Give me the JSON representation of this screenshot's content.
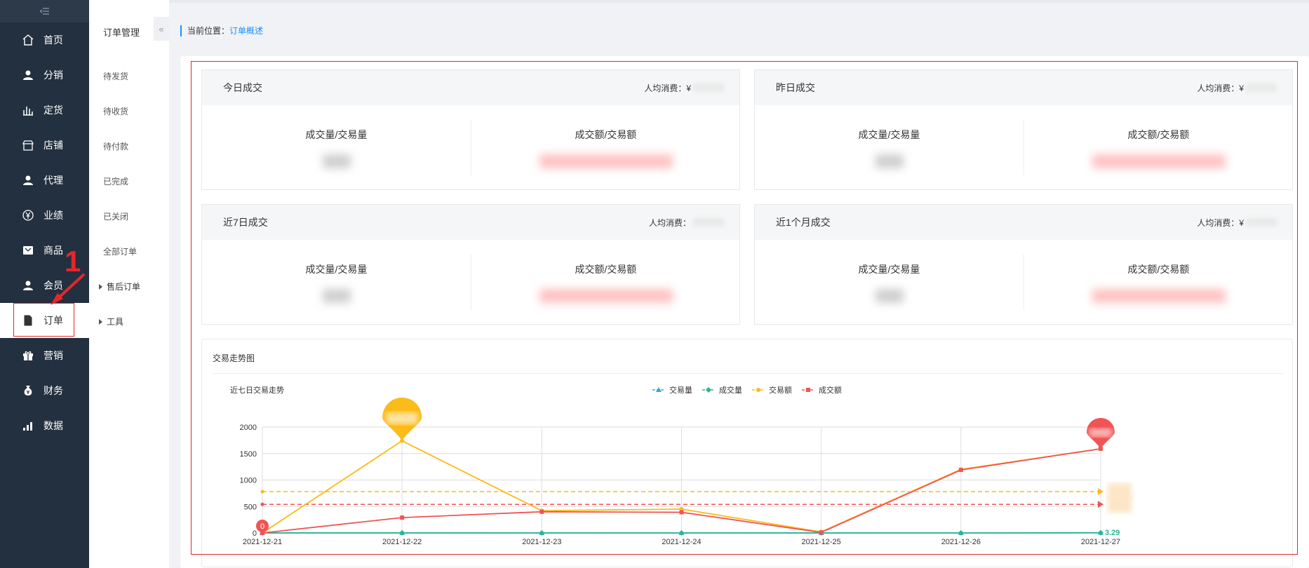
{
  "sidebar": {
    "collapse_icon": "menu-fold-icon",
    "items": [
      {
        "label": "首页",
        "icon": "home-icon"
      },
      {
        "label": "分销",
        "icon": "user-icon"
      },
      {
        "label": "定货",
        "icon": "bar-chart-icon"
      },
      {
        "label": "店铺",
        "icon": "shop-icon"
      },
      {
        "label": "代理",
        "icon": "user-icon"
      },
      {
        "label": "业绩",
        "icon": "yen-icon"
      },
      {
        "label": "商品",
        "icon": "goods-icon"
      },
      {
        "label": "会员",
        "icon": "user-icon"
      },
      {
        "label": "订单",
        "icon": "document-icon"
      },
      {
        "label": "营销",
        "icon": "gift-icon"
      },
      {
        "label": "财务",
        "icon": "money-bag-icon"
      },
      {
        "label": "数据",
        "icon": "data-icon"
      }
    ],
    "active_index": 8,
    "annotation_number": "1"
  },
  "submenu": {
    "title": "订单管理",
    "collapse_label": "«",
    "items": [
      "待发货",
      "待收货",
      "待付款",
      "已完成",
      "已关闭",
      "全部订单"
    ],
    "groups": [
      "售后订单",
      "工具"
    ]
  },
  "breadcrumb": {
    "prefix": "当前位置：",
    "current": "订单概述"
  },
  "cards": [
    {
      "title": "今日成交",
      "avg_label": "人均消费：¥",
      "col1": "成交量/交易量",
      "col2": "成交额/交易额"
    },
    {
      "title": "昨日成交",
      "avg_label": "人均消费：¥",
      "col1": "成交量/交易量",
      "col2": "成交额/交易额"
    },
    {
      "title": "近7日成交",
      "avg_label": "人均消费：",
      "col1": "成交量/交易量",
      "col2": "成交额/交易额"
    },
    {
      "title": "近1个月成交",
      "avg_label": "人均消费：¥",
      "col1": "成交量/交易量",
      "col2": "成交额/交易额"
    }
  ],
  "chart_section_title": "交易走势图",
  "colors": {
    "sidebar_bg": "#23303f",
    "accent_blue": "#1890ff",
    "annotation_red": "#e5262a",
    "series_blue": "#38a6e6",
    "series_green": "#2db58d",
    "series_yellow": "#fbbb18",
    "series_red": "#f05454"
  },
  "chart_data": {
    "type": "line",
    "title": "近七日交易走势",
    "x": [
      "2021-12-21",
      "2021-12-22",
      "2021-12-23",
      "2021-12-24",
      "2021-12-25",
      "2021-12-26",
      "2021-12-27"
    ],
    "ylim": [
      0,
      2000
    ],
    "yticks": [
      0,
      500,
      1000,
      1500,
      2000
    ],
    "grid": true,
    "legend_position": "top-center",
    "series": [
      {
        "name": "交易量",
        "values": [
          0,
          2,
          0,
          0,
          0,
          0,
          3.29
        ],
        "color": "#38a6e6",
        "marker": "triangle"
      },
      {
        "name": "成交量",
        "values": [
          0,
          1,
          0,
          0,
          0,
          0,
          3.29
        ],
        "color": "#2db58d",
        "marker": "diamond"
      },
      {
        "name": "交易额",
        "values": [
          0,
          1740,
          420,
          450,
          20,
          1200,
          1590
        ],
        "color": "#fbbb18",
        "marker": "circle"
      },
      {
        "name": "成交额",
        "values": [
          0,
          290,
          400,
          390,
          10,
          1190,
          1590
        ],
        "color": "#f05454",
        "marker": "square"
      }
    ],
    "average_lines": [
      {
        "series": "交易额",
        "value": 780
      },
      {
        "series": "成交额",
        "value": 540
      }
    ],
    "markpoints": [
      {
        "series": "成交额",
        "index": 0,
        "label": "0"
      },
      {
        "series": "交易额",
        "index": 1
      },
      {
        "series": "成交额",
        "index": 6
      }
    ],
    "end_label": "3.29"
  }
}
